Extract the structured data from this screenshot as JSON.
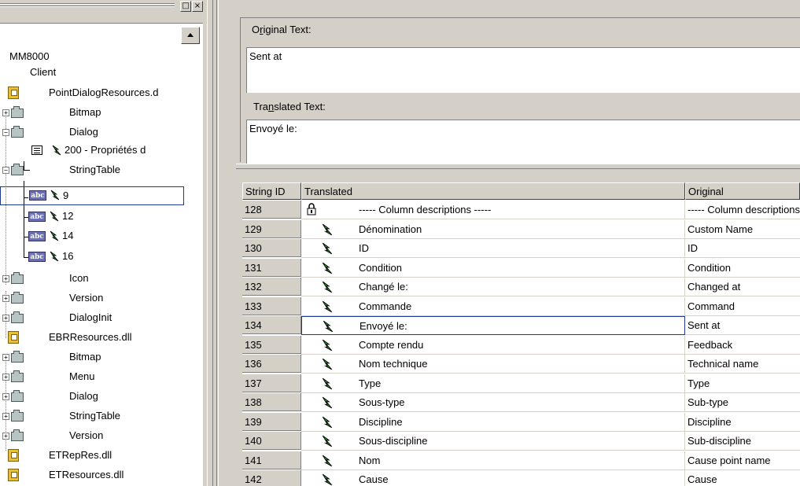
{
  "tree": {
    "items": [
      {
        "label": "MM8000",
        "type": "root"
      },
      {
        "label": "Client",
        "type": "node"
      },
      {
        "label": "PointDialogResources.d",
        "type": "dll"
      },
      {
        "label": "Bitmap",
        "type": "folder"
      },
      {
        "label": "Dialog",
        "type": "folder"
      },
      {
        "label": "200 - Propriétés d",
        "type": "dialog"
      },
      {
        "label": "StringTable",
        "type": "folder"
      },
      {
        "label": "9",
        "type": "abc"
      },
      {
        "label": "12",
        "type": "abc"
      },
      {
        "label": "14",
        "type": "abc"
      },
      {
        "label": "16",
        "type": "abc"
      },
      {
        "label": "Icon",
        "type": "folder"
      },
      {
        "label": "Version",
        "type": "folder"
      },
      {
        "label": "DialogInit",
        "type": "folder"
      },
      {
        "label": "EBRResources.dll",
        "type": "dll"
      },
      {
        "label": "Bitmap",
        "type": "folder"
      },
      {
        "label": "Menu",
        "type": "folder"
      },
      {
        "label": "Dialog",
        "type": "folder"
      },
      {
        "label": "StringTable",
        "type": "folder"
      },
      {
        "label": "Version",
        "type": "folder"
      },
      {
        "label": "ETRepRes.dll",
        "type": "dll"
      },
      {
        "label": "ETResources.dll",
        "type": "dll"
      }
    ],
    "abc_label": "abc"
  },
  "window_buttons": {
    "restore": "□",
    "close": "×"
  },
  "original": {
    "label_pre": "O",
    "label_u": "r",
    "label_post": "iginal Text:",
    "value": "Sent at"
  },
  "translated": {
    "label_pre": "Tra",
    "label_u": "n",
    "label_post": "slated Text:",
    "value": "Envoyé le:"
  },
  "grid": {
    "headers": [
      "String ID",
      "Translated",
      "Original"
    ],
    "rows": [
      {
        "id": "128",
        "translated": "----- Column descriptions -----",
        "original": "----- Column descriptions -----",
        "icon": "lock-icon"
      },
      {
        "id": "129",
        "translated": "Dénomination",
        "original": "Custom Name",
        "icon": "green-arrow-icon"
      },
      {
        "id": "130",
        "translated": "ID",
        "original": "ID",
        "icon": "green-arrow-icon"
      },
      {
        "id": "131",
        "translated": "Condition",
        "original": "Condition",
        "icon": "green-arrow-icon"
      },
      {
        "id": "132",
        "translated": "Changé le:",
        "original": "Changed at",
        "icon": "green-arrow-icon"
      },
      {
        "id": "133",
        "translated": "Commande",
        "original": "Command",
        "icon": "green-arrow-icon"
      },
      {
        "id": "134",
        "translated": "Envoyé le:",
        "original": "Sent at",
        "icon": "green-arrow-icon",
        "selected": true
      },
      {
        "id": "135",
        "translated": "Compte rendu",
        "original": "Feedback",
        "icon": "green-arrow-icon"
      },
      {
        "id": "136",
        "translated": "Nom technique",
        "original": "Technical name",
        "icon": "green-arrow-icon"
      },
      {
        "id": "137",
        "translated": "Type",
        "original": "Type",
        "icon": "green-arrow-icon"
      },
      {
        "id": "138",
        "translated": "Sous-type",
        "original": "Sub-type",
        "icon": "green-arrow-icon"
      },
      {
        "id": "139",
        "translated": "Discipline",
        "original": "Discipline",
        "icon": "green-arrow-icon"
      },
      {
        "id": "140",
        "translated": "Sous-discipline",
        "original": "Sub-discipline",
        "icon": "green-arrow-icon"
      },
      {
        "id": "141",
        "translated": "Nom",
        "original": "Cause point name",
        "icon": "green-arrow-icon"
      },
      {
        "id": "142",
        "translated": "Cause",
        "original": "Cause",
        "icon": "green-arrow-icon"
      }
    ]
  },
  "colors": {
    "face": "#d4d0c8",
    "selection_border": "#1e3a8a",
    "arrow_green": "#2a9a2a"
  }
}
